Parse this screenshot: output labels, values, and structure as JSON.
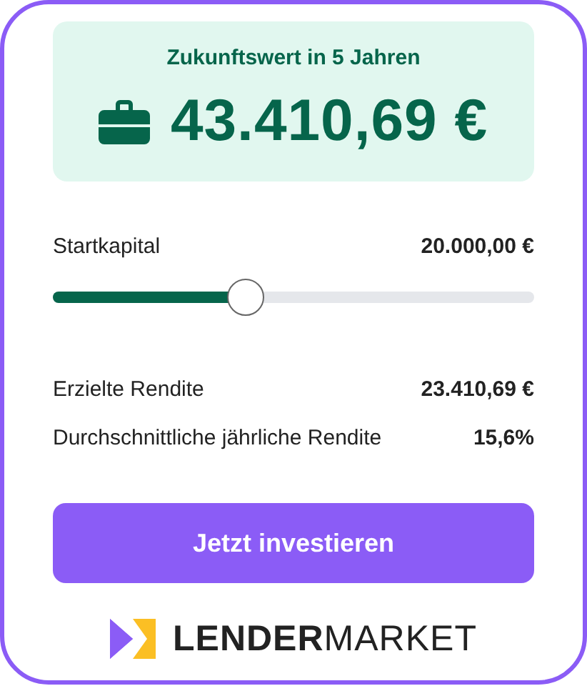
{
  "summary": {
    "title": "Zukunftswert in 5 Jahren",
    "amount": "43.410,69 €"
  },
  "slider": {
    "label": "Startkapital",
    "reading": "20.000,00 €",
    "level": 0.4
  },
  "stats": [
    {
      "label": "Erzielte Rendite",
      "value": "23.410,69 €"
    },
    {
      "label": "Durchschnittliche jährliche Rendite",
      "value": "15,6%"
    }
  ],
  "button": "Jetzt investieren",
  "logo": "**LENDER**MARKET"
}
